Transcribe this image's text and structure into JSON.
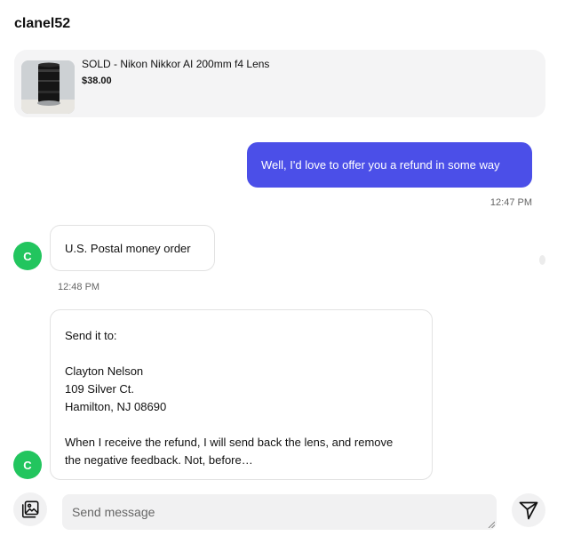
{
  "header": {
    "title": "clanel52"
  },
  "item": {
    "title": "SOLD - Nikon Nikkor AI 200mm f4 Lens",
    "price": "$38.00"
  },
  "messages": [
    {
      "direction": "outgoing",
      "text": "Well, I'd love to offer you a refund in some way",
      "time": "12:47 PM"
    },
    {
      "direction": "incoming",
      "avatar": "C",
      "text": "U.S. Postal money order",
      "time": "12:48 PM"
    },
    {
      "direction": "incoming",
      "avatar": "C",
      "lines": [
        "Send it to:",
        "",
        "Clayton Nelson",
        "109 Silver Ct.",
        "Hamilton, NJ 08690",
        "",
        "When I receive the refund, I will send back the lens, and remove",
        "the negative feedback. Not, before…"
      ]
    }
  ],
  "composer": {
    "placeholder": "Send message",
    "gallery_icon": "image-gallery-icon",
    "send_icon": "send-icon"
  },
  "colors": {
    "outgoing_bubble": "#4b4fe8",
    "avatar": "#22c55e"
  }
}
